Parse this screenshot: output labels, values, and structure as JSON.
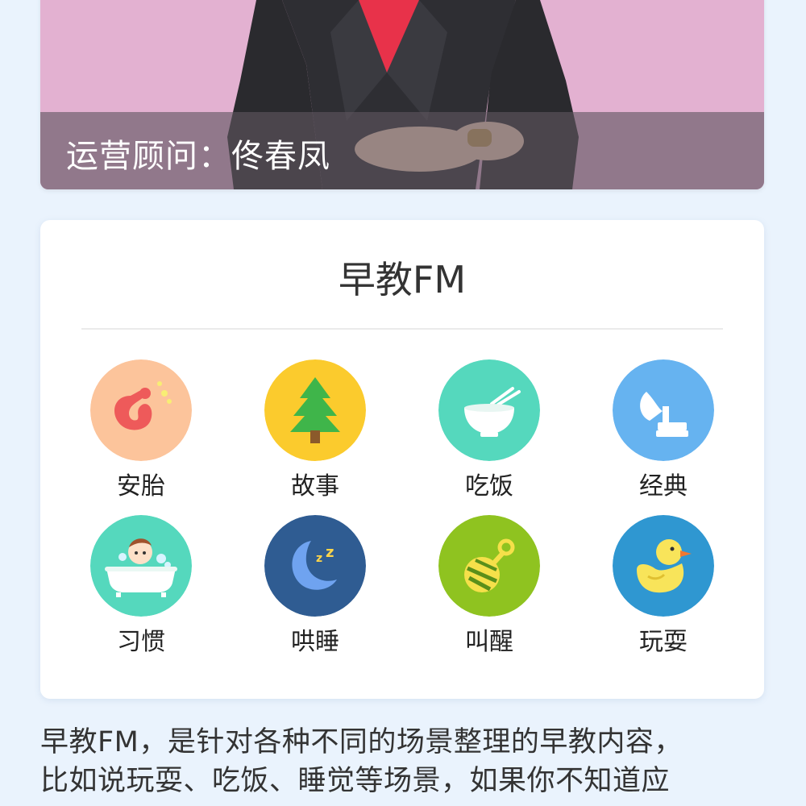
{
  "advisor": {
    "caption": "运营顾问：佟春凤"
  },
  "fm": {
    "title": "早教FM",
    "items": [
      {
        "label": "安胎",
        "icon": "fetus-icon",
        "color": "#fcc49b"
      },
      {
        "label": "故事",
        "icon": "pine-tree-icon",
        "color": "#fbcb2d"
      },
      {
        "label": "吃饭",
        "icon": "rice-bowl-icon",
        "color": "#55d8bd"
      },
      {
        "label": "经典",
        "icon": "gramophone-icon",
        "color": "#66b3f0"
      },
      {
        "label": "习惯",
        "icon": "baby-bath-icon",
        "color": "#55d8bd"
      },
      {
        "label": "哄睡",
        "icon": "moon-sleep-icon",
        "color": "#2f5c92"
      },
      {
        "label": "叫醒",
        "icon": "rattle-icon",
        "color": "#8fc320"
      },
      {
        "label": "玩耍",
        "icon": "rubber-duck-icon",
        "color": "#2f97d1"
      }
    ]
  },
  "description": {
    "lines": [
      "早教FM，是针对各种不同的场景整理的早教内容，",
      "比如说玩耍、吃饭、睡觉等场景，如果你不知道应"
    ]
  }
}
